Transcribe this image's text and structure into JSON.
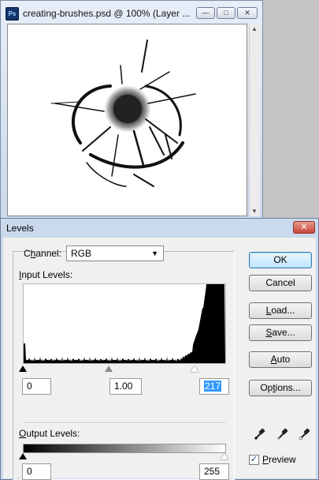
{
  "document": {
    "title": "creating-brushes.psd @ 100% (Layer ...",
    "app_icon": "Ps",
    "buttons": {
      "minimize": "—",
      "maximize": "□",
      "close": "✕"
    }
  },
  "dialog": {
    "title": "Levels",
    "close_glyph": "✕",
    "channel": {
      "label_prefix": "C",
      "label_underlined": "h",
      "label_suffix": "annel:",
      "value": "RGB"
    },
    "input_levels": {
      "label_underlined": "I",
      "label_rest": "nput Levels:",
      "black": "0",
      "gamma": "1.00",
      "white": "217",
      "white_position_fraction": 0.851
    },
    "output_levels": {
      "label_underlined": "O",
      "label_rest": "utput Levels:",
      "black": "0",
      "white": "255"
    },
    "buttons": {
      "ok": "OK",
      "cancel": "Cancel",
      "load_underlined": "L",
      "load_rest": "oad...",
      "save_underlined": "S",
      "save_rest": "ave...",
      "auto_underlined": "A",
      "auto_rest": "uto",
      "options_prefix": "Op",
      "options_underlined": "t",
      "options_suffix": "ions..."
    },
    "preview": {
      "checked": true,
      "label_underlined": "P",
      "label_rest": "review"
    },
    "icons": [
      "black-eyedropper-icon",
      "gray-eyedropper-icon",
      "white-eyedropper-icon"
    ]
  }
}
